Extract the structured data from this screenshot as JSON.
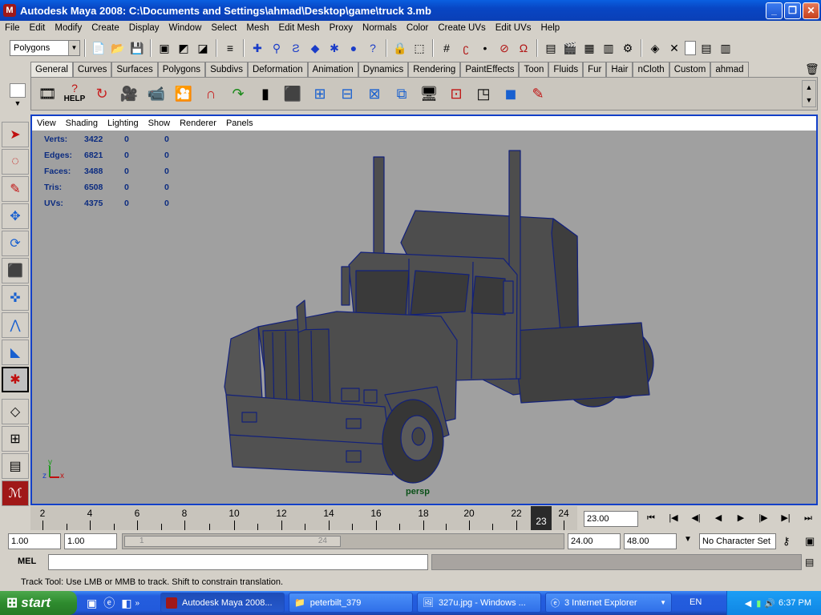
{
  "window": {
    "title": "Autodesk Maya 2008: C:\\Documents and Settings\\ahmad\\Desktop\\game\\truck 3.mb",
    "app_icon": "maya-icon"
  },
  "menus": [
    "File",
    "Edit",
    "Modify",
    "Create",
    "Display",
    "Window",
    "Select",
    "Mesh",
    "Edit Mesh",
    "Proxy",
    "Normals",
    "Color",
    "Create UVs",
    "Edit UVs",
    "Help"
  ],
  "status_line": {
    "mode": "Polygons"
  },
  "shelf_tabs": [
    "General",
    "Curves",
    "Surfaces",
    "Polygons",
    "Subdivs",
    "Deformation",
    "Animation",
    "Dynamics",
    "Rendering",
    "PaintEffects",
    "Toon",
    "Fluids",
    "Fur",
    "Hair",
    "nCloth",
    "Custom",
    "ahmad"
  ],
  "shelf_active_tab": "General",
  "shelf_help_label": "HELP",
  "panel_menu": [
    "View",
    "Shading",
    "Lighting",
    "Show",
    "Renderer",
    "Panels"
  ],
  "hud": [
    {
      "label": "Verts:",
      "v1": "3422",
      "v2": "0",
      "v3": "0"
    },
    {
      "label": "Edges:",
      "v1": "6821",
      "v2": "0",
      "v3": "0"
    },
    {
      "label": "Faces:",
      "v1": "3488",
      "v2": "0",
      "v3": "0"
    },
    {
      "label": "Tris:",
      "v1": "6508",
      "v2": "0",
      "v3": "0"
    },
    {
      "label": "UVs:",
      "v1": "4375",
      "v2": "0",
      "v3": "0"
    }
  ],
  "camera_label": "persp",
  "axis": {
    "x": "x",
    "y": "y",
    "z": "z"
  },
  "timeline": {
    "ticks": [
      "2",
      "4",
      "6",
      "8",
      "10",
      "12",
      "14",
      "16",
      "18",
      "20",
      "22",
      "24"
    ],
    "current_frame": "23",
    "current_time": "23.00"
  },
  "range": {
    "start_time": "1.00",
    "playback_start": "1.00",
    "range_start_label": "1",
    "range_end_label": "24",
    "playback_end": "24.00",
    "end_time": "48.00",
    "character_set": "No Character Set"
  },
  "command_line": {
    "label": "MEL"
  },
  "help_line": "Track Tool: Use LMB or MMB to track. Shift to constrain translation.",
  "taskbar": {
    "start": "start",
    "buttons": [
      {
        "label": "Autodesk Maya 2008...",
        "icon": "maya-icon",
        "active": true
      },
      {
        "label": "peterbilt_379",
        "icon": "folder-icon",
        "active": false
      },
      {
        "label": "327u.jpg - Windows ...",
        "icon": "image-icon",
        "active": false
      },
      {
        "label": "3 Internet Explorer",
        "icon": "ie-icon",
        "active": false
      }
    ],
    "lang": "EN",
    "clock": "6:37 PM"
  }
}
